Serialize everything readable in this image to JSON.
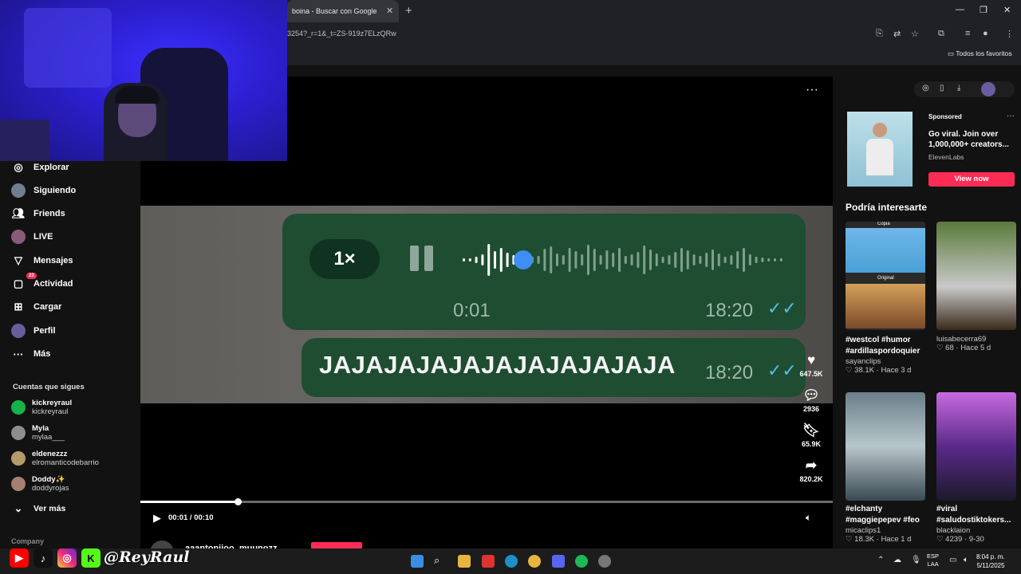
{
  "browser": {
    "tab_title": "boina - Buscar con Google",
    "url_fragment": "3254?_r=1&_t=ZS-919z7ELzQRw",
    "bookmarks_label": "Todos los favoritos"
  },
  "sidebar": {
    "items": [
      {
        "label": "Explorar",
        "icon": "compass-icon"
      },
      {
        "label": "Siguiendo",
        "icon": "avatar"
      },
      {
        "label": "Friends",
        "icon": "friends-icon"
      },
      {
        "label": "LIVE",
        "icon": "avatar"
      },
      {
        "label": "Mensajes",
        "icon": "send-icon"
      },
      {
        "label": "Actividad",
        "icon": "inbox-icon",
        "badge": "23"
      },
      {
        "label": "Cargar",
        "icon": "plus-square-icon"
      },
      {
        "label": "Perfil",
        "icon": "avatar"
      },
      {
        "label": "Más",
        "icon": "more-icon"
      }
    ],
    "following_title": "Cuentas que sigues",
    "following": [
      {
        "name": "kickreyraul",
        "handle": "kickreyraul"
      },
      {
        "name": "Myla",
        "handle": "mylaa___"
      },
      {
        "name": "eldenezzz",
        "handle": "elromanticodebarrio"
      },
      {
        "name": "Doddy✨",
        "handle": "doddyrojas"
      }
    ],
    "see_more": "Ver más",
    "company": "Company"
  },
  "video": {
    "speed": "1×",
    "elapsed": "0:01",
    "timestamp1": "18:20",
    "message": "JAJAJAJAJAJAJAJAJAJAJA",
    "timestamp2": "18:20",
    "likes": "647.5K",
    "comments": "2936",
    "saves": "65.9K",
    "shares": "820.2K",
    "time_readout": "00:01 / 00:10",
    "progress": 0.14,
    "author_handle": "aaantonjioo_muunozz"
  },
  "right": {
    "sponsored": "Sponsored",
    "ad_text": "Go viral. Join over 1,000,000+ creators...",
    "ad_brand": "ElevenLabs",
    "view_now": "View now",
    "section_title": "Podría interesarte",
    "cards": [
      {
        "label_top": "Copia",
        "label_mid": "Original",
        "title": "#westcol #humor #ardillaspordoquier",
        "author": "sayanclips",
        "likes": "38.1K",
        "age": "Hace 3 d"
      },
      {
        "title": "luisabecerra69",
        "author": "",
        "likes": "68",
        "age": "Hace 5 d"
      },
      {
        "title": "#elchanty #maggiepepev #feo",
        "author": "micaclips1",
        "likes": "18.3K",
        "age": "Hace 1 d"
      },
      {
        "title": "#viral #saludostiktokers...",
        "author": "blacklaion",
        "likes": "4239",
        "age": "9-30"
      }
    ]
  },
  "taskbar": {
    "lang": "ESP",
    "lang2": "LAA",
    "time": "8:04 p. m.",
    "date": "5/11/2025"
  },
  "overlay": {
    "tag": "@ReyRaul"
  }
}
